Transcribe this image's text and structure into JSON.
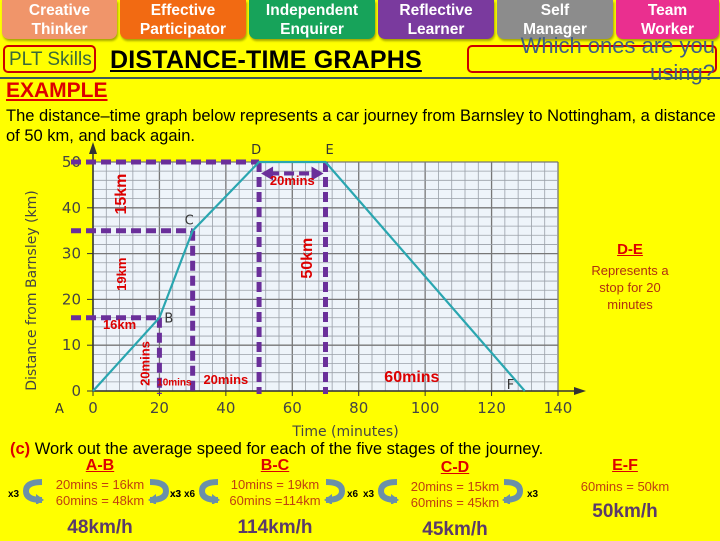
{
  "plt_skills": {
    "buttons": [
      {
        "label_line1": "Creative",
        "label_line2": "Thinker",
        "color": "#f0956a"
      },
      {
        "label_line1": "Effective",
        "label_line2": "Participator",
        "color": "#f26a12"
      },
      {
        "label_line1": "Independent",
        "label_line2": "Enquirer",
        "color": "#17a35a"
      },
      {
        "label_line1": "Reflective",
        "label_line2": "Learner",
        "color": "#7a3a9e"
      },
      {
        "label_line1": "Self",
        "label_line2": "Manager",
        "color": "#8c8c8c"
      },
      {
        "label_line1": "Team",
        "label_line2": "Worker",
        "color": "#ea2f8f"
      }
    ],
    "label": "PLT Skills",
    "prompt": "Which ones are you using?"
  },
  "header": {
    "title": "DISTANCE-TIME GRAPHS",
    "example_label": "EXAMPLE",
    "intro": "The distance–time graph below represents a car journey from Barnsley to Nottingham, a distance of 50 km, and back again."
  },
  "chart_data": {
    "type": "line",
    "title": "",
    "xlabel": "Time (minutes)",
    "ylabel": "Distance from Barnsley (km)",
    "xlim": [
      0,
      140
    ],
    "ylim": [
      0,
      50
    ],
    "x_ticks": [
      0,
      20,
      40,
      60,
      80,
      100,
      120,
      140
    ],
    "y_ticks": [
      0,
      10,
      20,
      30,
      40,
      50
    ],
    "grid": true,
    "series": [
      {
        "name": "Journey",
        "color": "#2aa6b0",
        "points": [
          {
            "label": "A",
            "x": 0,
            "y": 0
          },
          {
            "label": "B",
            "x": 20,
            "y": 16
          },
          {
            "label": "C",
            "x": 30,
            "y": 35
          },
          {
            "label": "D",
            "x": 50,
            "y": 50
          },
          {
            "label": "E",
            "x": 70,
            "y": 50
          },
          {
            "label": "F",
            "x": 130,
            "y": 0
          }
        ]
      }
    ],
    "annotations": {
      "guide_color": "#6a2f9a",
      "label_color": "#dd0000",
      "labels": [
        {
          "text": "15km",
          "x": 10,
          "y": 43,
          "rotate": true
        },
        {
          "text": "19km",
          "x": 10,
          "y": 25.5,
          "rotate": true
        },
        {
          "text": "16km",
          "x": 8,
          "y": 13.5,
          "rotate": false
        },
        {
          "text": "20mins",
          "x": 17,
          "y": 6,
          "rotate": true
        },
        {
          "text": "10mins",
          "x": 24.5,
          "y": 1.2,
          "rotate": false
        },
        {
          "text": "20mins",
          "x": 40,
          "y": 1.5,
          "rotate": false
        },
        {
          "text": "20mins",
          "x": 60,
          "y": 45,
          "rotate": false
        },
        {
          "text": "50km",
          "x": 66,
          "y": 29,
          "rotate": true
        },
        {
          "text": "60mins",
          "x": 96,
          "y": 2,
          "rotate": false
        }
      ]
    }
  },
  "de_note": {
    "title": "D-E",
    "text": "Represents a stop for 20 minutes"
  },
  "question": {
    "number": "(c)",
    "text": "Work out the average speed for each of the five stages of the journey."
  },
  "stages": [
    {
      "title": "A-B",
      "line1": "20mins = 16km",
      "line2": "60mins = 48km",
      "answer": "48km/h",
      "mult_left": "x3",
      "mult_right": "x3"
    },
    {
      "title": "B-C",
      "line1": "10mins = 19km",
      "line2": "60mins =114km",
      "answer": "114km/h",
      "mult_left": "x6",
      "mult_right": "x6"
    },
    {
      "title": "C-D",
      "line1": "20mins = 15km",
      "line2": "60mins = 45km",
      "answer": "45km/h",
      "mult_left": "x3",
      "mult_right": "x3"
    },
    {
      "title": "E-F",
      "line1": "60mins = 50km",
      "answer": "50km/h"
    }
  ]
}
